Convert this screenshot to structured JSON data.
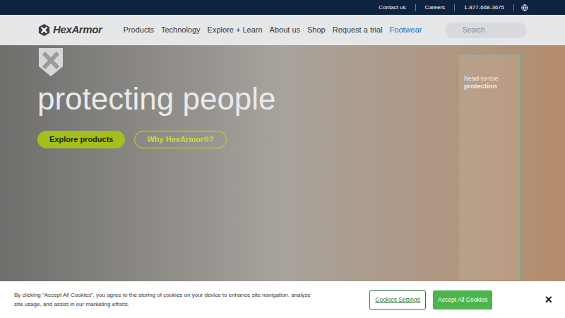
{
  "top_bar": {
    "links": [
      "Contact us",
      "Careers",
      "1-877-668-3675"
    ]
  },
  "logo": {
    "text": "HexArmor"
  },
  "nav": {
    "items": [
      {
        "label": "Products",
        "selected": false
      },
      {
        "label": "Technology",
        "selected": false
      },
      {
        "label": "Explore + Learn",
        "selected": false
      },
      {
        "label": "About us",
        "selected": false
      },
      {
        "label": "Shop",
        "selected": false
      },
      {
        "label": "Request a trial",
        "selected": false
      },
      {
        "label": "Footwear",
        "selected": true
      }
    ]
  },
  "search": {
    "placeholder": "Search"
  },
  "hero": {
    "headline": "protecting people",
    "tagline": [
      "head-to-toe",
      "protection"
    ],
    "buttons": [
      {
        "label": "Explore products",
        "kind": "filled"
      },
      {
        "label": "Why HexArmor®?",
        "kind": "outline"
      }
    ]
  },
  "cookie_banner": {
    "text": "By clicking “Accept All Cookies”, you agree to the storing of cookies on your device to enhance site navigation, analyze site usage, and assist in our marketing efforts.",
    "buttons": [
      {
        "label": "Cookies Settings",
        "kind": "outline"
      },
      {
        "label": "Accept All Cookies",
        "kind": "filled"
      }
    ],
    "close": "×"
  }
}
